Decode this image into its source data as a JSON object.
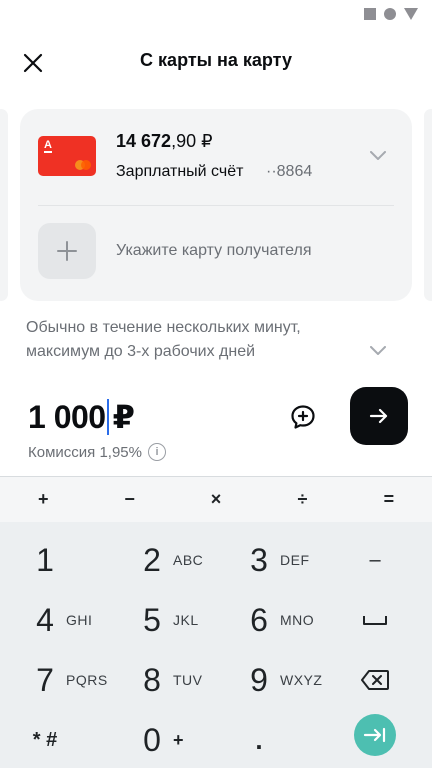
{
  "header": {
    "title": "С карты на карту",
    "close_icon": "close-icon"
  },
  "source": {
    "balance_int": "14 672",
    "balance_frac": ",90 ₽",
    "account_name": "Зарплатный счёт",
    "account_mask": "··8864",
    "card_logo": "A",
    "card_color": "#ef3124"
  },
  "recipient": {
    "placeholder": "Укажите карту получателя"
  },
  "info": {
    "line1": "Обычно в течение нескольких минут,",
    "line2": "максимум до 3-х рабочих дней"
  },
  "amount": {
    "value": "1 000",
    "currency": "₽",
    "commission": "Комиссия 1,95%",
    "info_glyph": "i"
  },
  "keyboard": {
    "ops": [
      "+",
      "−",
      "×",
      "÷",
      "="
    ],
    "keys": [
      {
        "num": "1",
        "letters": ""
      },
      {
        "num": "2",
        "letters": "ABC"
      },
      {
        "num": "3",
        "letters": "DEF"
      },
      {
        "num": "4",
        "letters": "GHI"
      },
      {
        "num": "5",
        "letters": "JKL"
      },
      {
        "num": "6",
        "letters": "MNO"
      },
      {
        "num": "7",
        "letters": "PQRS"
      },
      {
        "num": "8",
        "letters": "TUV"
      },
      {
        "num": "9",
        "letters": "WXYZ"
      },
      {
        "num": "* #",
        "letters": ""
      },
      {
        "num": "0",
        "letters": "+"
      },
      {
        "num": ".",
        "letters": ""
      }
    ],
    "minus_key": "–",
    "accent_color": "#4dbfb1"
  }
}
